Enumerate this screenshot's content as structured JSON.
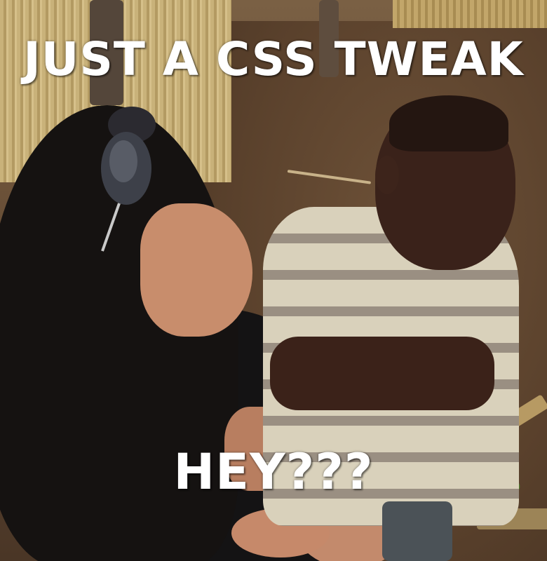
{
  "meme": {
    "top_text": "JUST A CSS TWEAK",
    "bottom_text": "HEY???"
  },
  "colors": {
    "caption_text": "#ffffff",
    "ground": "#5a412c",
    "fence": "#c9b27a"
  }
}
